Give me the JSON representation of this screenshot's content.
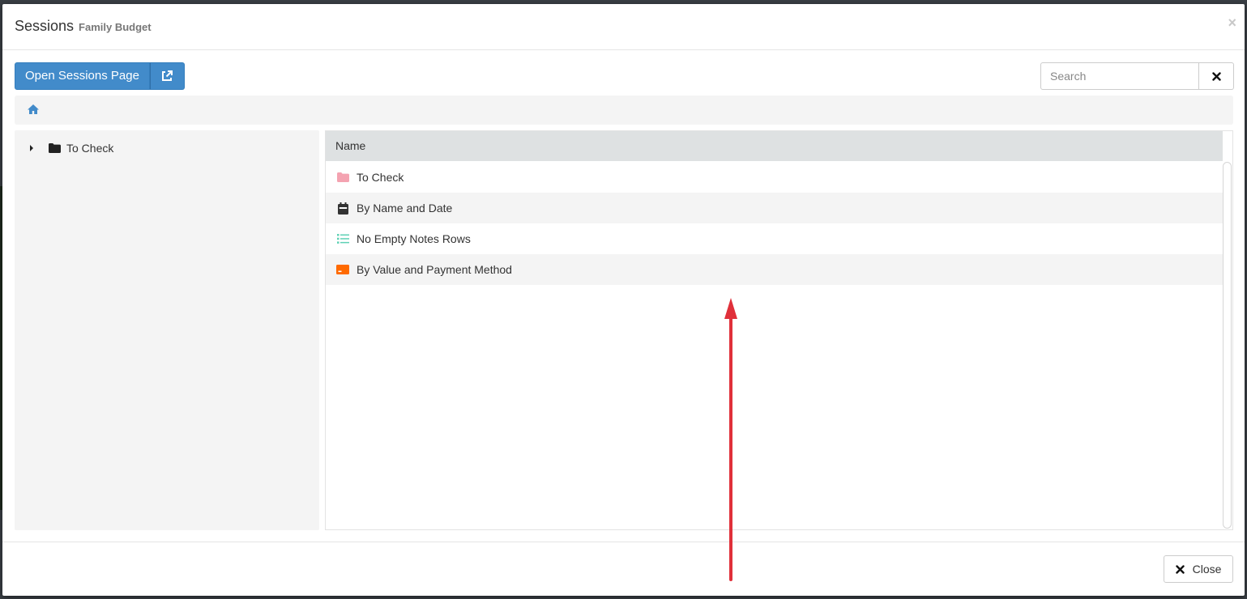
{
  "modal": {
    "title": "Sessions",
    "subtitle": "Family Budget",
    "close_symbol": "×"
  },
  "toolbar": {
    "open_sessions_label": "Open Sessions Page",
    "external_link_icon": "external-link-icon"
  },
  "search": {
    "placeholder": "Search",
    "value": ""
  },
  "breadcrumb": {
    "home_icon": "home-icon",
    "accent_color": "#428bca"
  },
  "tree": {
    "items": [
      {
        "label": "To Check",
        "icon": "folder-icon",
        "expanded": false
      }
    ]
  },
  "list": {
    "column_header": "Name",
    "rows": [
      {
        "label": "To Check",
        "icon": "folder-icon",
        "icon_color": "#f4a3b1"
      },
      {
        "label": "By Name and Date",
        "icon": "calendar-icon",
        "icon_color": "#333333"
      },
      {
        "label": "No Empty Notes Rows",
        "icon": "list-icon",
        "icon_color": "#5fd1b5"
      },
      {
        "label": "By Value and Payment Method",
        "icon": "card-icon",
        "icon_color": "#ff6a00"
      }
    ]
  },
  "footer": {
    "close_label": "Close"
  },
  "colors": {
    "primary": "#428bca",
    "annotation_arrow": "#e0303a"
  }
}
